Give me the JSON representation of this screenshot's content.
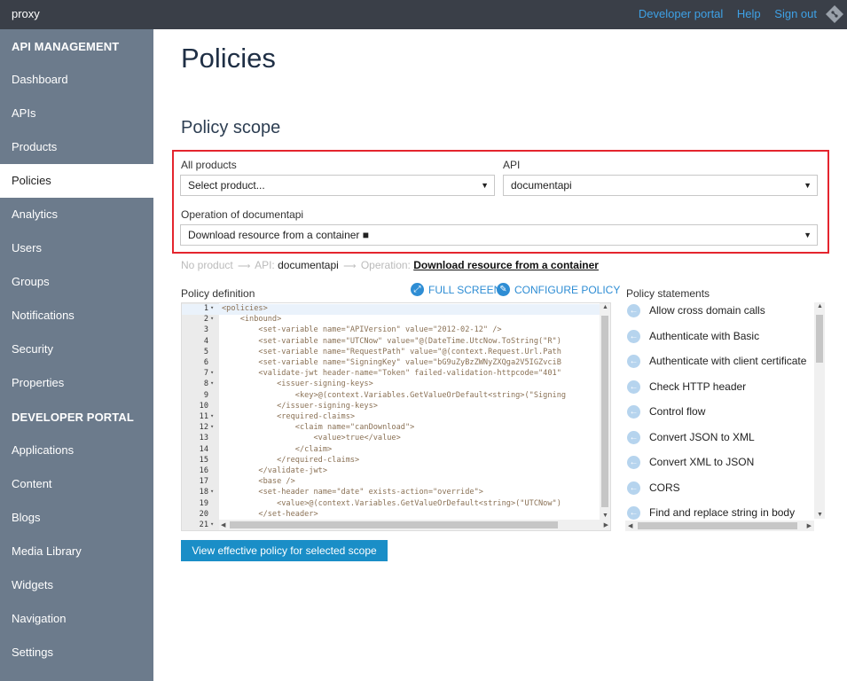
{
  "topbar": {
    "brand": "proxy",
    "links": [
      "Developer portal",
      "Help",
      "Sign out"
    ]
  },
  "sidebar": {
    "sections": [
      {
        "header": "API MANAGEMENT",
        "items": [
          "Dashboard",
          "APIs",
          "Products",
          "Policies",
          "Analytics",
          "Users",
          "Groups",
          "Notifications",
          "Security",
          "Properties"
        ]
      },
      {
        "header": "DEVELOPER PORTAL",
        "items": [
          "Applications",
          "Content",
          "Blogs",
          "Media Library",
          "Widgets",
          "Navigation",
          "Settings"
        ]
      }
    ],
    "active": "Policies"
  },
  "page": {
    "title": "Policies",
    "scope_title": "Policy scope"
  },
  "scope": {
    "products_label": "All products",
    "products_value": "Select product...",
    "api_label": "API",
    "api_value": "documentapi",
    "operation_label": "Operation of documentapi",
    "operation_value": "Download resource from a container ■"
  },
  "breadcrumb": {
    "no_product": "No product",
    "api_prefix": "API:",
    "api": "documentapi",
    "operation_prefix": "Operation:",
    "operation": "Download resource from a container"
  },
  "policy_definition": {
    "label": "Policy definition",
    "full_screen": "FULL SCREEN",
    "configure": "CONFIGURE POLICY",
    "lines": [
      {
        "n": "1",
        "fold": true,
        "code": "<policies>"
      },
      {
        "n": "2",
        "fold": true,
        "code": "    <inbound>"
      },
      {
        "n": "3",
        "fold": false,
        "code": "        <set-variable name=\"APIVersion\" value=\"2012-02-12\" />"
      },
      {
        "n": "4",
        "fold": false,
        "code": "        <set-variable name=\"UTCNow\" value=\"@(DateTime.UtcNow.ToString(\"R\")"
      },
      {
        "n": "5",
        "fold": false,
        "code": "        <set-variable name=\"RequestPath\" value=\"@(context.Request.Url.Path"
      },
      {
        "n": "6",
        "fold": false,
        "code": "        <set-variable name=\"SigningKey\" value=\"bG9uZyBzZWNyZXQga2V5IGZvciB"
      },
      {
        "n": "7",
        "fold": true,
        "code": "        <validate-jwt header-name=\"Token\" failed-validation-httpcode=\"401\""
      },
      {
        "n": "8",
        "fold": true,
        "code": "            <issuer-signing-keys>"
      },
      {
        "n": "9",
        "fold": false,
        "code": "                <key>@(context.Variables.GetValueOrDefault<string>(\"Signing"
      },
      {
        "n": "10",
        "fold": false,
        "code": "            </issuer-signing-keys>"
      },
      {
        "n": "11",
        "fold": true,
        "code": "            <required-claims>"
      },
      {
        "n": "12",
        "fold": true,
        "code": "                <claim name=\"canDownload\">"
      },
      {
        "n": "13",
        "fold": false,
        "code": "                    <value>true</value>"
      },
      {
        "n": "14",
        "fold": false,
        "code": "                </claim>"
      },
      {
        "n": "15",
        "fold": false,
        "code": "            </required-claims>"
      },
      {
        "n": "16",
        "fold": false,
        "code": "        </validate-jwt>"
      },
      {
        "n": "17",
        "fold": false,
        "code": "        <base />"
      },
      {
        "n": "18",
        "fold": true,
        "code": "        <set-header name=\"date\" exists-action=\"override\">"
      },
      {
        "n": "19",
        "fold": false,
        "code": "            <value>@(context.Variables.GetValueOrDefault<string>(\"UTCNow\")"
      },
      {
        "n": "20",
        "fold": false,
        "code": "        </set-header>"
      },
      {
        "n": "21",
        "fold": true,
        "code": ""
      }
    ]
  },
  "policy_statements": {
    "label": "Policy statements",
    "items": [
      "Allow cross domain calls",
      "Authenticate with Basic",
      "Authenticate with client certificate",
      "Check HTTP header",
      "Control flow",
      "Convert JSON to XML",
      "Convert XML to JSON",
      "CORS",
      "Find and replace string in body"
    ]
  },
  "view_button": "View effective policy for selected scope",
  "colors": {
    "topbar": "#3a3f48",
    "sidebar": "#6c7b8c",
    "accent": "#1a8ec7",
    "highlight_border": "#e4252e"
  }
}
